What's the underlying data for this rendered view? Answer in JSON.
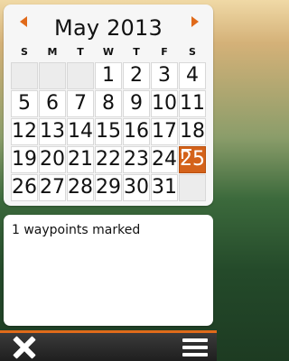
{
  "calendar": {
    "month_title": "May 2013",
    "weekdays": [
      "S",
      "M",
      "T",
      "W",
      "T",
      "F",
      "S"
    ],
    "weeks": [
      [
        "",
        "",
        "",
        "1",
        "2",
        "3",
        "4"
      ],
      [
        "5",
        "6",
        "7",
        "8",
        "9",
        "10",
        "11"
      ],
      [
        "12",
        "13",
        "14",
        "15",
        "16",
        "17",
        "18"
      ],
      [
        "19",
        "20",
        "21",
        "22",
        "23",
        "24",
        "25"
      ],
      [
        "26",
        "27",
        "28",
        "29",
        "30",
        "31",
        ""
      ]
    ],
    "selected_day": "25",
    "accent_color": "#d4621a"
  },
  "info": {
    "message": "1 waypoints marked"
  },
  "toolbar": {
    "close_icon": "close-icon",
    "menu_icon": "menu-icon"
  }
}
